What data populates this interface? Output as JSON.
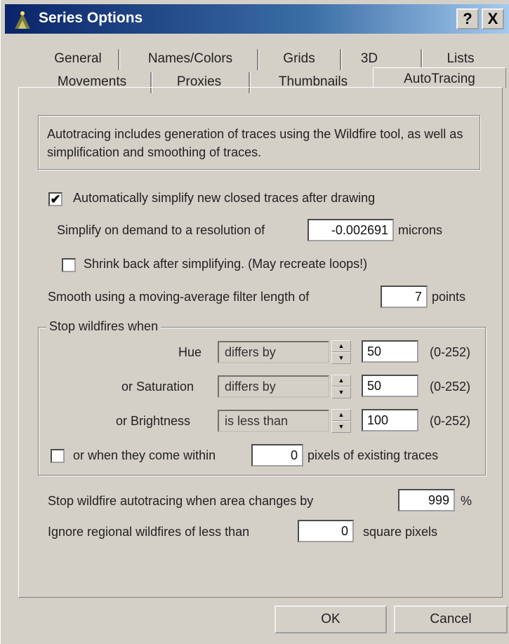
{
  "window": {
    "title": "Series Options",
    "help_label": "?",
    "close_label": "X"
  },
  "tabs": {
    "row1": [
      "General",
      "Names/Colors",
      "Grids",
      "3D",
      "Lists"
    ],
    "row2": [
      "Movements",
      "Proxies",
      "Thumbnails",
      "AutoTracing"
    ],
    "active": "AutoTracing"
  },
  "info": {
    "text": "Autotracing includes generation of traces using the Wildfire tool, as well as simplification and smoothing of traces."
  },
  "options": {
    "auto_simplify": {
      "label": "Automatically simplify new closed traces after drawing",
      "checked": true,
      "mark": "✔"
    },
    "simplify": {
      "label": "Simplify on demand to a resolution of",
      "value": "-0.002691",
      "unit": "microns"
    },
    "shrink_back": {
      "label": "Shrink back after simplifying. (May recreate loops!)",
      "checked": false
    },
    "smooth": {
      "label": "Smooth using a moving-average filter length of",
      "value": "7",
      "unit": "points"
    }
  },
  "wildfire": {
    "group_title": "Stop wildfires when",
    "rows": [
      {
        "label": "Hue",
        "condition": "differs by",
        "value": "50",
        "range": "(0-252)"
      },
      {
        "label": "or Saturation",
        "condition": "differs by",
        "value": "50",
        "range": "(0-252)"
      },
      {
        "label": "or Brightness",
        "condition": "is less than",
        "value": "100",
        "range": "(0-252)"
      }
    ],
    "within": {
      "label": "or when they come within",
      "checked": false,
      "value": "0",
      "unit": "pixels of existing traces"
    }
  },
  "autotrace": {
    "label": "Stop wildfire autotracing when area changes by",
    "value": "999",
    "unit": "%"
  },
  "ignore": {
    "label": "Ignore regional wildfires of less than",
    "value": "0",
    "unit": "square pixels"
  },
  "buttons": {
    "ok": "OK",
    "cancel": "Cancel"
  }
}
